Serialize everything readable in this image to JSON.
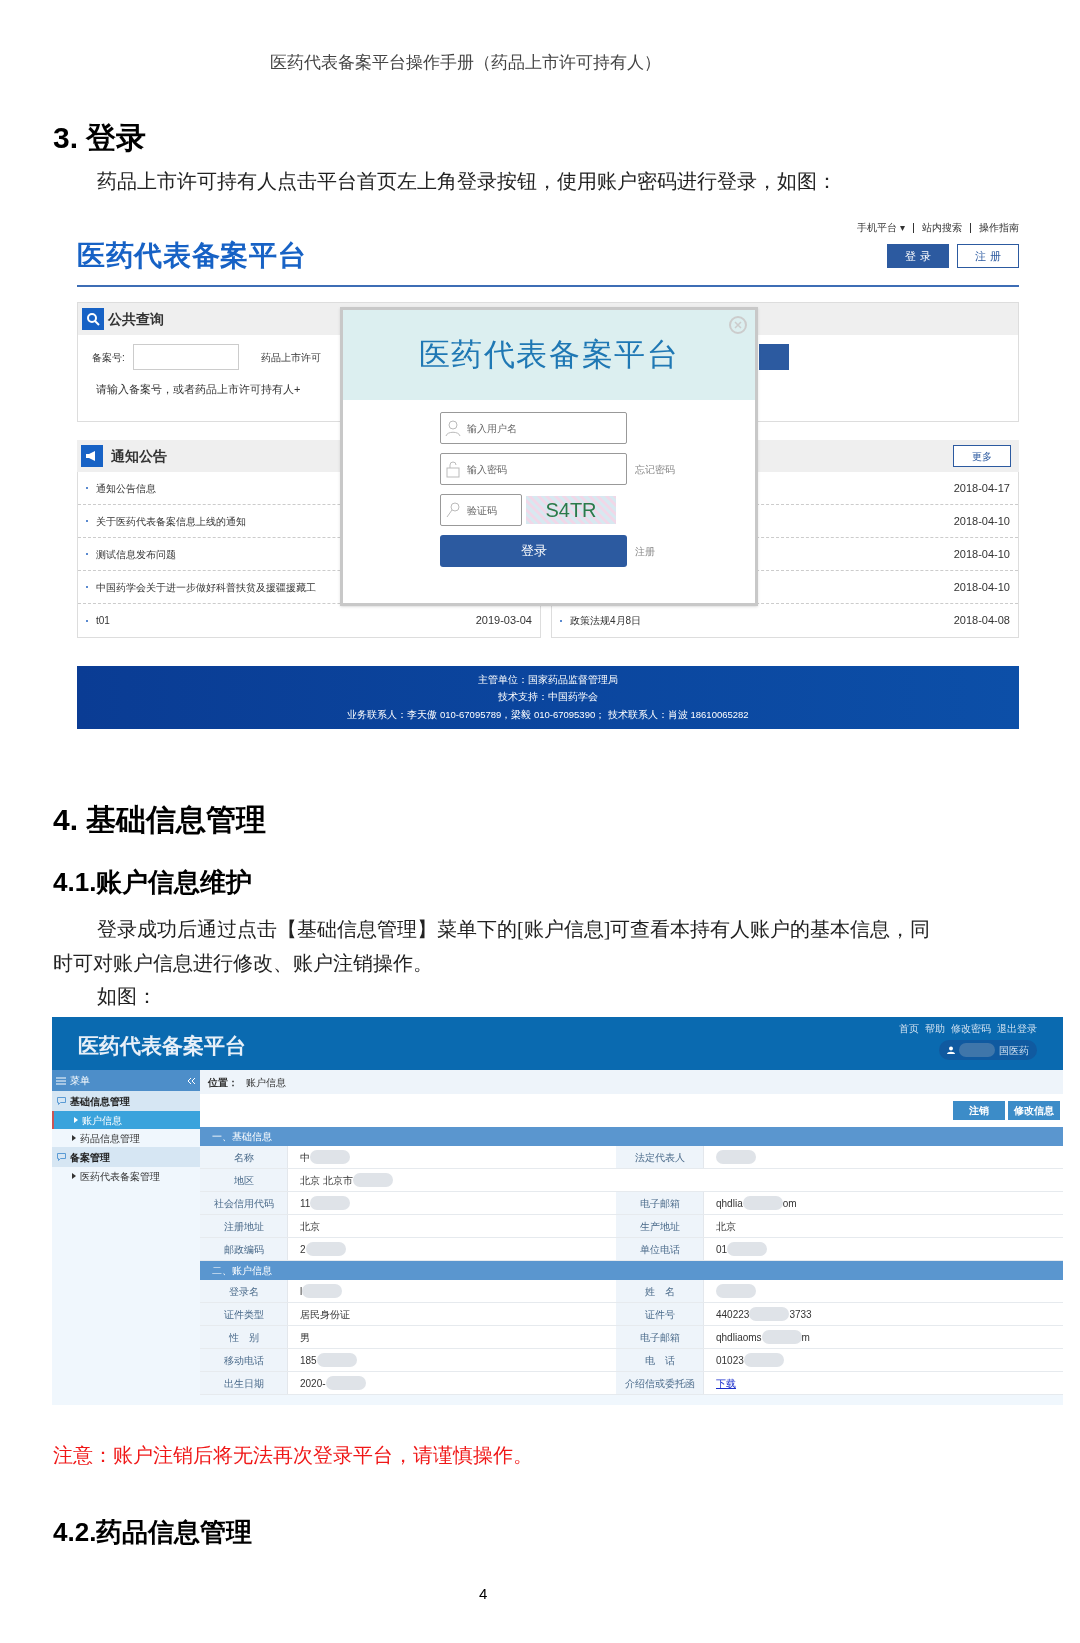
{
  "doc_header": "医药代表备案平台操作手册（药品上市许可持有人）",
  "login_section": {
    "heading": "3. 登录",
    "paragraph": "药品上市许可持有人点击平台首页左上角登录按钮，使用账户密码进行登录，如图："
  },
  "home_screen": {
    "logo": "医药代表备案平台",
    "top_links": [
      {
        "label": "手机平台 ▾"
      },
      {
        "label": "站内搜索"
      },
      {
        "label": "操作指南"
      }
    ],
    "login_button": "登 录",
    "register_button": "注 册",
    "query_panel": {
      "title": "公共查询",
      "field_label": "备案号:",
      "field_label_2": "药品上市许可",
      "hint": "请输入备案号，或者药品上市许可持有人+"
    },
    "notice_panel": {
      "title": "通知公告",
      "more": "更多",
      "left": [
        {
          "title": "通知公告信息"
        },
        {
          "title": "关于医药代表备案信息上线的通知"
        },
        {
          "title": "测试信息发布问题"
        },
        {
          "title": "中国药学会关于进一步做好科普扶贫及援疆援藏工"
        },
        {
          "title": "t01",
          "date": "2019-03-04"
        }
      ],
      "right": [
        {
          "date": "2018-04-17"
        },
        {
          "date": "2018-04-10"
        },
        {
          "date": "2018-04-10"
        },
        {
          "date": "2018-04-10"
        },
        {
          "title": "政策法规4月8日",
          "date": "2018-04-08"
        }
      ]
    },
    "footer": [
      "主管单位：国家药品监督管理局",
      "技术支持：中国药学会",
      "业务联系人：李天傲 010-67095789，梁毅 010-67095390；  技术联系人：肖波 18610065282"
    ],
    "login_dialog": {
      "logo": "医药代表备案平台",
      "username_placeholder": "输入用户名",
      "password_placeholder": "输入密码",
      "forgot": "忘记密码",
      "captcha_placeholder": "验证码",
      "captcha": "S4TR",
      "submit": "登录",
      "register": "注册"
    }
  },
  "info_section": {
    "heading": "4. 基础信息管理",
    "subheading": "4.1.账户信息维护",
    "paragraph": "登录成功后通过点击【基础信息管理】菜单下的[账户信息]可查看本持有人账户的基本信息，同时可对账户信息进行修改、账户注销操作。",
    "figure_caption": "如图："
  },
  "account_screen": {
    "logo": "医药代表备案平台",
    "top_links": [
      {
        "label": "首页"
      },
      {
        "label": "帮助"
      },
      {
        "label": "修改密码"
      },
      {
        "label": "退出登录"
      }
    ],
    "user": {
      "tail": "国医药"
    },
    "menu_title": "菜单",
    "menu": [
      {
        "label": "基础信息管理",
        "children": [
          {
            "label": "账户信息",
            "selected": true
          },
          {
            "label": "药品信息管理",
            "selected": false
          }
        ]
      },
      {
        "label": "备案管理",
        "children": [
          {
            "label": "医药代表备案管理",
            "selected": false
          }
        ]
      }
    ],
    "breadcrumb_label": "位置：",
    "breadcrumb": "账户信息",
    "actions": [
      {
        "label": "注销"
      },
      {
        "label": "修改信息"
      }
    ],
    "sections": [
      {
        "title": "一、基础信息",
        "rows": [
          [
            {
              "label": "名称",
              "value": "中",
              "masked": true
            },
            {
              "label": "法定代表人",
              "masked": true
            }
          ],
          [
            {
              "label": "地区",
              "value": "北京 北京市",
              "masked": true
            }
          ],
          [
            {
              "label": "社会信用代码",
              "value": "11",
              "masked": true
            },
            {
              "label": "电子邮箱",
              "value": "qhdlia",
              "masked": true,
              "tail": "om"
            }
          ],
          [
            {
              "label": "注册地址",
              "value": "北京",
              "masked": false
            },
            {
              "label": "生产地址",
              "value": "北京",
              "masked": false
            }
          ],
          [
            {
              "label": "邮政编码",
              "value": "2",
              "masked": true
            },
            {
              "label": "单位电话",
              "value": "01",
              "masked": true
            }
          ]
        ]
      },
      {
        "title": "二、账户信息",
        "rows": [
          [
            {
              "label": "登录名",
              "value": "l",
              "masked": true
            },
            {
              "label": "姓　名",
              "masked": true
            }
          ],
          [
            {
              "label": "证件类型",
              "value": "居民身份证",
              "masked": false
            },
            {
              "label": "证件号",
              "value": "440223",
              "masked": true,
              "tail": "3733"
            }
          ],
          [
            {
              "label": "性　别",
              "value": "男",
              "masked": false
            },
            {
              "label": "电子邮箱",
              "value": "qhdliaoms",
              "masked": true,
              "tail": "m"
            }
          ],
          [
            {
              "label": "移动电话",
              "value": "185",
              "masked": true
            },
            {
              "label": "电　话",
              "value": "01023",
              "masked": true
            }
          ],
          [
            {
              "label": "出生日期",
              "value": "2020-",
              "masked": true
            },
            {
              "label": "介绍信或委托函",
              "value": "下载",
              "kind": "link",
              "masked": false
            }
          ]
        ]
      }
    ]
  },
  "note": "注意：账户注销后将无法再次登录平台，请谨慎操作。",
  "next_heading": "4.2.药品信息管理",
  "page_number": "4"
}
